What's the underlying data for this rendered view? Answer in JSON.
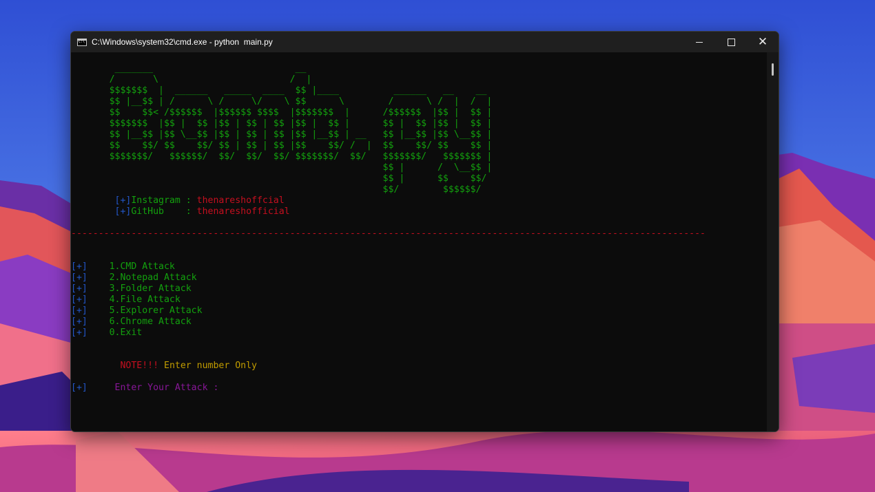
{
  "window": {
    "title": "C:\\Windows\\system32\\cmd.exe - python  main.py",
    "controls": {
      "minimize": "–",
      "maximize": "□",
      "close": "✕"
    }
  },
  "console": {
    "banner": [
      "        _______                          __                                    ",
      "       /       \\                        /  |                                   ",
      "       $$$$$$$  |  ______   _____  ____  $$ |____          ______   __    __   ",
      "       $$ |__$$ | /      \\ /     \\/    \\ $$      \\        /      \\ /  |  /  |  ",
      "       $$    $$< /$$$$$$  |$$$$$$ $$$$  |$$$$$$$  |      /$$$$$$  |$$ |  $$ |  ",
      "       $$$$$$$  |$$ |  $$ |$$ | $$ | $$ |$$ |  $$ |      $$ |  $$ |$$ |  $$ |  ",
      "       $$ |__$$ |$$ \\__$$ |$$ | $$ | $$ |$$ |__$$ | __   $$ |__$$ |$$ \\__$$ |  ",
      "       $$    $$/ $$    $$/ $$ | $$ | $$ |$$    $$/ /  |  $$    $$/ $$    $$ |  ",
      "       $$$$$$$/   $$$$$$/  $$/  $$/  $$/ $$$$$$$/  $$/   $$$$$$$/   $$$$$$$ |  ",
      "                                                         $$ |      /  \\__$$ |  ",
      "                                                         $$ |      $$    $$/   ",
      "                                                         $$/        $$$$$$/    "
    ],
    "socials": [
      {
        "tag": "[+]",
        "label": "Instagram : ",
        "value": "thenareshoffcial"
      },
      {
        "tag": "[+]",
        "label": "GitHub    : ",
        "value": "thenareshofficial"
      }
    ],
    "divider": "--------------------------------------------------------------------------------------------------------------------",
    "menu": [
      {
        "tag": "[+]",
        "label": "1.CMD Attack"
      },
      {
        "tag": "[+]",
        "label": "2.Notepad Attack"
      },
      {
        "tag": "[+]",
        "label": "3.Folder Attack"
      },
      {
        "tag": "[+]",
        "label": "4.File Attack"
      },
      {
        "tag": "[+]",
        "label": "5.Explorer Attack"
      },
      {
        "tag": "[+]",
        "label": "6.Chrome Attack"
      },
      {
        "tag": "[+]",
        "label": "0.Exit"
      }
    ],
    "note": {
      "label": "NOTE!!! ",
      "text": "Enter number Only"
    },
    "prompt": {
      "tag": "[+]",
      "text": "Enter Your Attack :"
    }
  },
  "colors": {
    "terminal_bg": "#0c0c0c",
    "green": "#13a10e",
    "blue": "#2357c9",
    "red": "#c50f1f",
    "yellow": "#c19c00",
    "purple": "#881798"
  },
  "icons": [
    "cmd-app-icon",
    "minimize-icon",
    "maximize-icon",
    "close-icon"
  ]
}
